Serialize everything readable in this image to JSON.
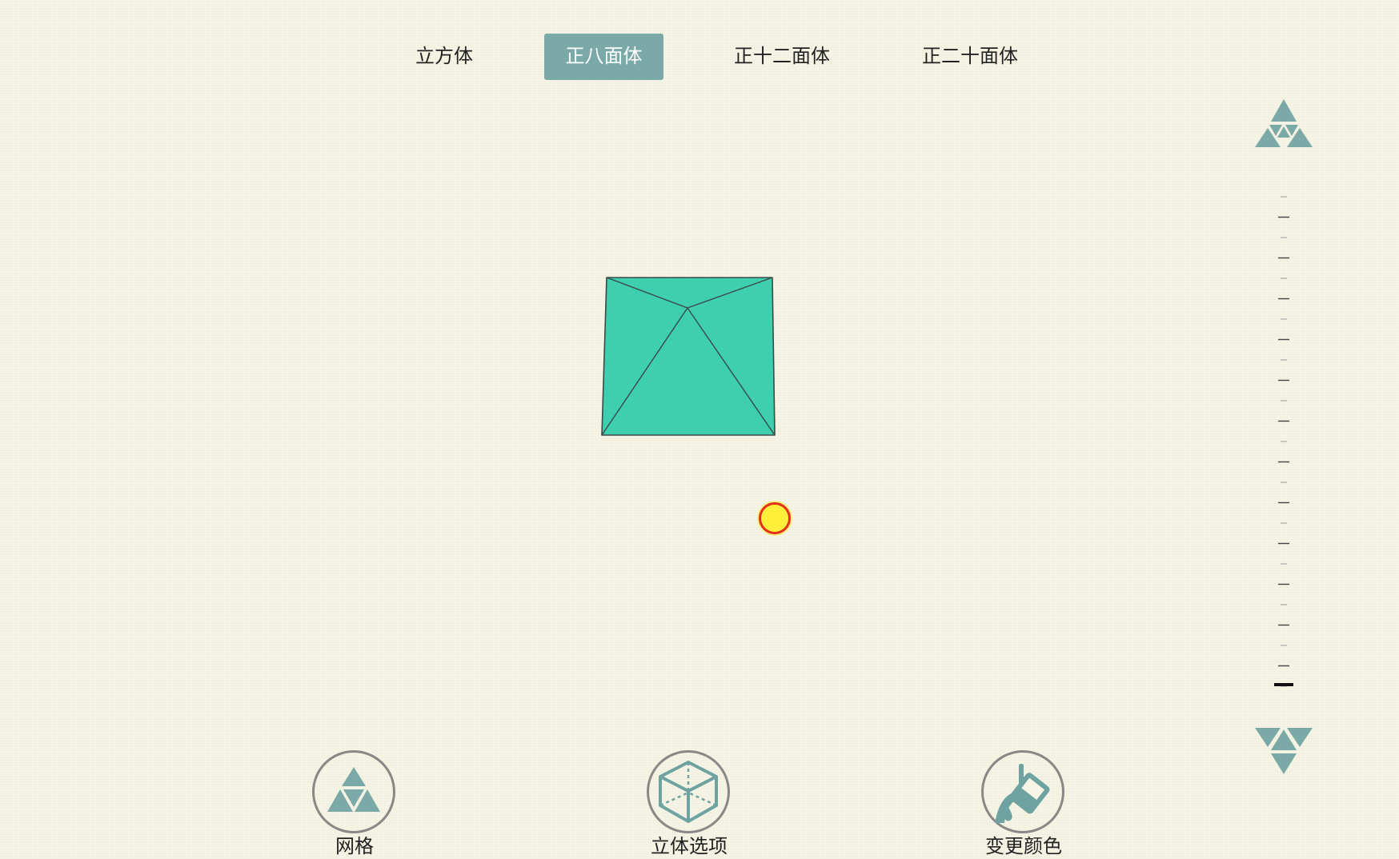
{
  "tabs": [
    {
      "label": "立方体",
      "active": false
    },
    {
      "label": "正八面体",
      "active": true
    },
    {
      "label": "正十二面体",
      "active": false
    },
    {
      "label": "正二十面体",
      "active": false
    }
  ],
  "colors": {
    "accent": "#7aa9a8",
    "solid_fill": "#3ecfae",
    "solid_edge": "#3a4a48",
    "pointer_fill": "#ffef3a",
    "pointer_ring": "#e03018"
  },
  "zoom": {
    "in_icon": "triangle-grid-up-icon",
    "out_icon": "triangle-grid-down-icon",
    "level_fraction": 0
  },
  "tools": [
    {
      "label": "网格",
      "icon": "triangle-grid-icon"
    },
    {
      "label": "立体选项",
      "icon": "cube-icon"
    },
    {
      "label": "变更颜色",
      "icon": "paint-bucket-icon"
    }
  ]
}
